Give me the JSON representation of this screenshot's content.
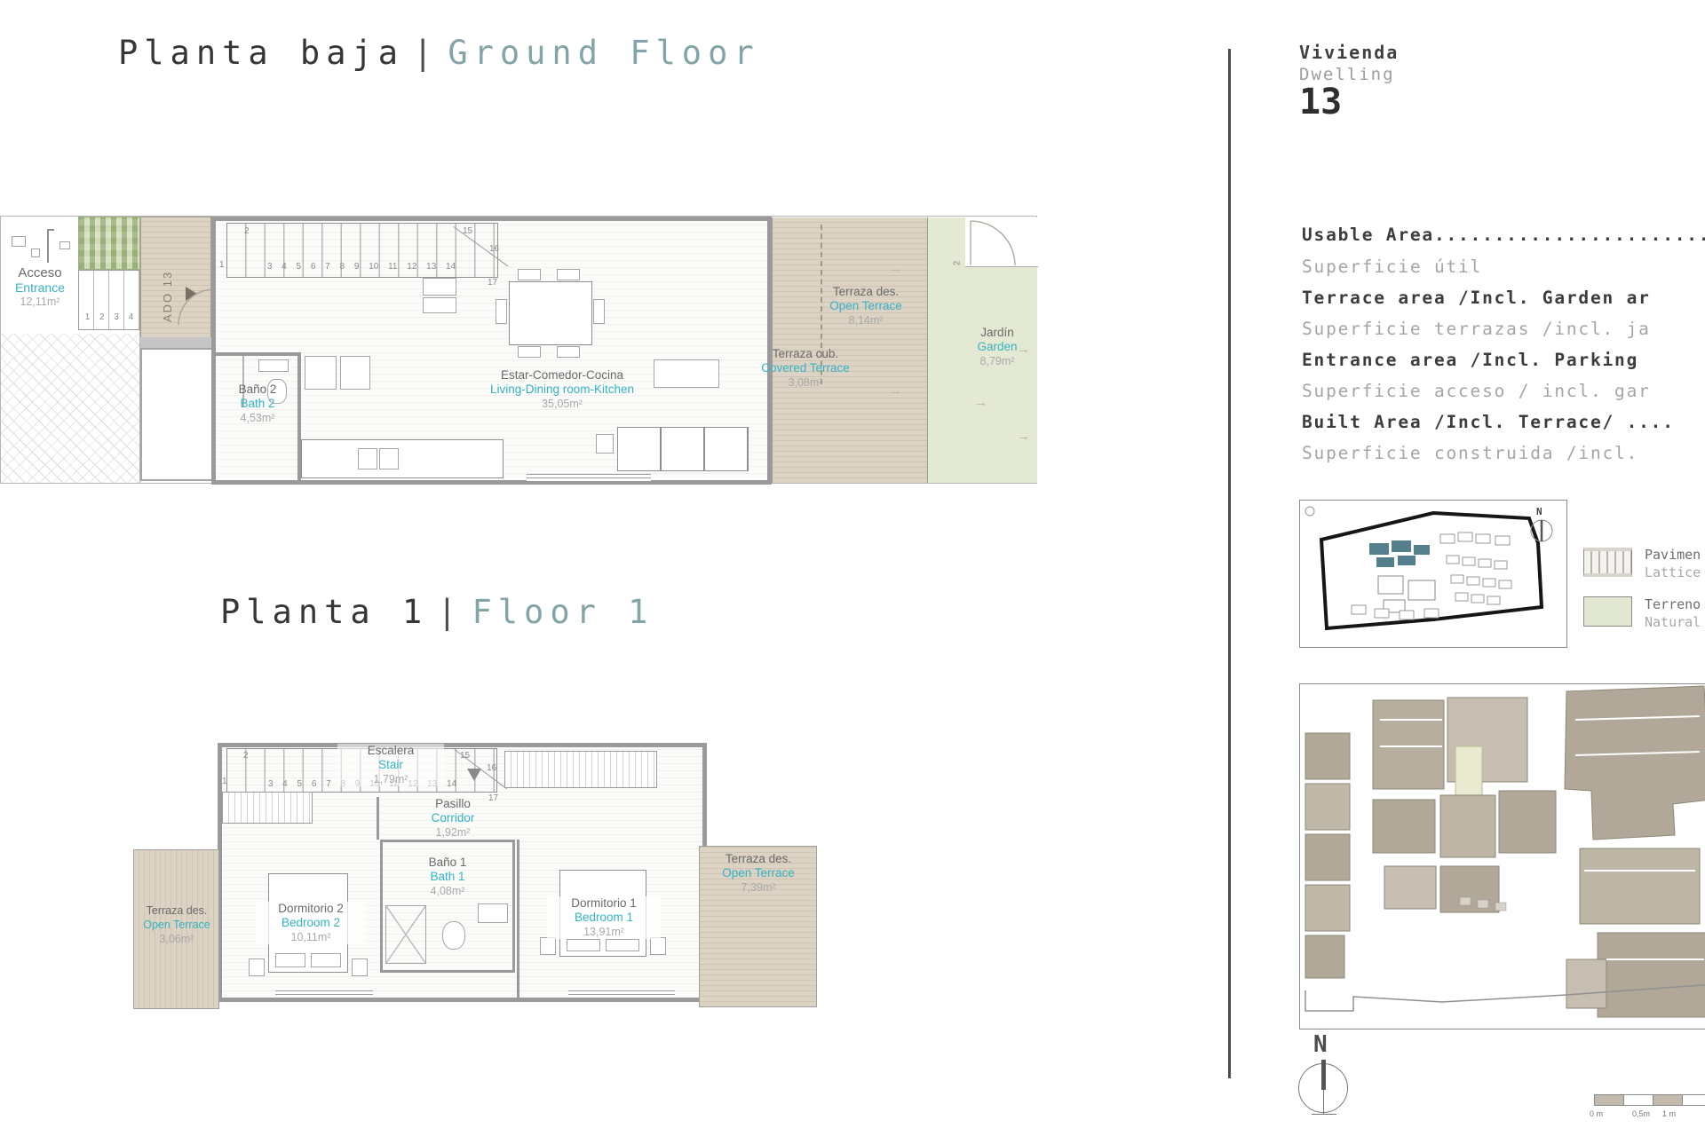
{
  "colors": {
    "accent_teal": "#35b2c4",
    "title_teal": "#84a5a7",
    "deck_beige": "#d6cdbe",
    "garden_green": "#e4e9d4",
    "wall_gray": "#9a9a9a",
    "text_dark": "#3c3c3c",
    "text_gray": "#a5a5a5"
  },
  "titles": {
    "ground": {
      "es": "Planta baja",
      "sep": "|",
      "en": "Ground Floor"
    },
    "floor1": {
      "es": "Planta 1",
      "sep": "|",
      "en": "Floor 1"
    }
  },
  "ground_floor": {
    "rooms": {
      "acceso": {
        "es": "Acceso",
        "en": "Entrance",
        "area": "12,11m²"
      },
      "bano2": {
        "es": "Baño 2",
        "en": "Bath 2",
        "area": "4,53m²"
      },
      "estar": {
        "es": "Estar-Comedor-Cocina",
        "en": "Living-Dining room-Kitchen",
        "area": "35,05m²"
      },
      "terraza_des": {
        "es": "Terraza des.",
        "en": "Open Terrace",
        "area": "8,14m²"
      },
      "terraza_cub": {
        "es": "Terraza cub.",
        "en": "Covered Terrace",
        "area": "3,08m²"
      },
      "jardin": {
        "es": "Jardín",
        "en": "Garden",
        "area": "8,79m²"
      }
    },
    "ado_label": "ADO 13",
    "entry_steps": "1 2 3 4",
    "stairs": {
      "m1": "1",
      "m2": "2",
      "row": "3 4 5 6 7 8 9 10 11 12 13 14",
      "m15": "15",
      "m16": "16",
      "m17": "17"
    },
    "garden_door_mark": "2",
    "arrow": "→"
  },
  "floor1": {
    "rooms": {
      "escalera": {
        "es": "Escalera",
        "en": "Stair",
        "area": "1,79m²"
      },
      "pasillo": {
        "es": "Pasillo",
        "en": "Corridor",
        "area": "1,92m²"
      },
      "bano1": {
        "es": "Baño 1",
        "en": "Bath 1",
        "area": "4,08m²"
      },
      "dorm2": {
        "es": "Dormitorio 2",
        "en": "Bedroom 2",
        "area": "10,11m²"
      },
      "dorm1": {
        "es": "Dormitorio 1",
        "en": "Bedroom 1",
        "area": "13,91m²"
      },
      "terraza_left": {
        "es": "Terraza des.",
        "en": "Open Terrace",
        "area": "3,06m²"
      },
      "terraza_right": {
        "es": "Terraza des.",
        "en": "Open Terrace",
        "area": "7,39m²"
      }
    },
    "stairs": {
      "m1": "1",
      "m2": "2",
      "row": "3 4 5 6 7 8 9 10 11 12 13 14",
      "m15": "15",
      "m16": "16",
      "m17": "17"
    }
  },
  "panel": {
    "dwelling": {
      "es": "Vivienda",
      "en": "Dwelling",
      "number": "13"
    },
    "specs": [
      {
        "en": "Usable Area........................",
        "es": "Superficie útil"
      },
      {
        "en": "Terrace area /Incl. Garden ar",
        "es": "Superficie terrazas /incl. ja"
      },
      {
        "en": "Entrance area /Incl. Parking ",
        "es": "Superficie acceso / incl. gar"
      },
      {
        "en": "Built Area /Incl. Terrace/ ....",
        "es": "Superficie construida /incl. "
      }
    ],
    "legend": [
      {
        "line1": "Pavimen",
        "line2": "Lattice"
      },
      {
        "line1": "Terreno",
        "line2": "Natural"
      }
    ],
    "mini_compass_label": "N",
    "compass_label": "N",
    "scale_labels": [
      "0 m",
      "0,5m",
      "1 m"
    ]
  }
}
